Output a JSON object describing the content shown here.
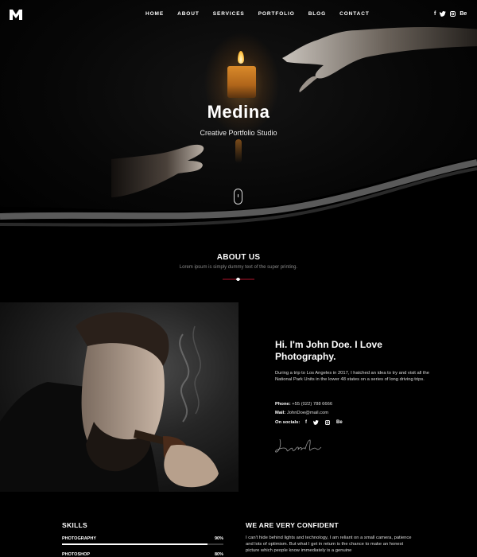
{
  "nav": {
    "logo_icon": "m-logo-icon",
    "links": [
      "HOME",
      "ABOUT",
      "SERVICES",
      "PORTFOLIO",
      "BLOG",
      "CONTACT"
    ],
    "socials": [
      "f",
      "t",
      "ig",
      "Be"
    ]
  },
  "hero": {
    "title": "Medina",
    "subtitle": "Creative Portfolio Studio",
    "scroll_icon": "mouse-scroll-icon"
  },
  "about": {
    "title": "ABOUT US",
    "subtitle": "Lorem ipsum is simply dummy text of the super printing.",
    "divider_accent": "#b0142c"
  },
  "bio": {
    "heading_line1": "Hi. I'm John Doe. I Love",
    "heading_line2": "Photography.",
    "text": "During a trip to Los Angeles in 2017, I hatched an idea to try and visit all the National Park Units in the lower 48 states on a series of long driving trips.",
    "phone_label": "Phone:",
    "phone_value": "+55 (022) 788 6666",
    "mail_label": "Mail:",
    "mail_value": "JohnDoe@mail.com",
    "socials_label": "On socials:",
    "socials": [
      "f",
      "t",
      "ig",
      "Be"
    ],
    "signature": "John Doe"
  },
  "skills": {
    "title": "SKILLS",
    "items": [
      {
        "name": "PHOTOGRAPHY",
        "percent_label": "90%",
        "level": 0.9
      },
      {
        "name": "PHOTOSHOP",
        "percent_label": "80%",
        "level": 0.8
      }
    ]
  },
  "confident": {
    "title": "WE ARE VERY CONFIDENT",
    "text": "I can't hide behind lights and technology, I am reliant on a small camera, patience and lots of optimism. But what I get in return is the chance to make an honest picture which people know immediately is a genuine"
  },
  "colors": {
    "background": "#000000",
    "text": "#ffffff",
    "accent": "#b0142c"
  }
}
